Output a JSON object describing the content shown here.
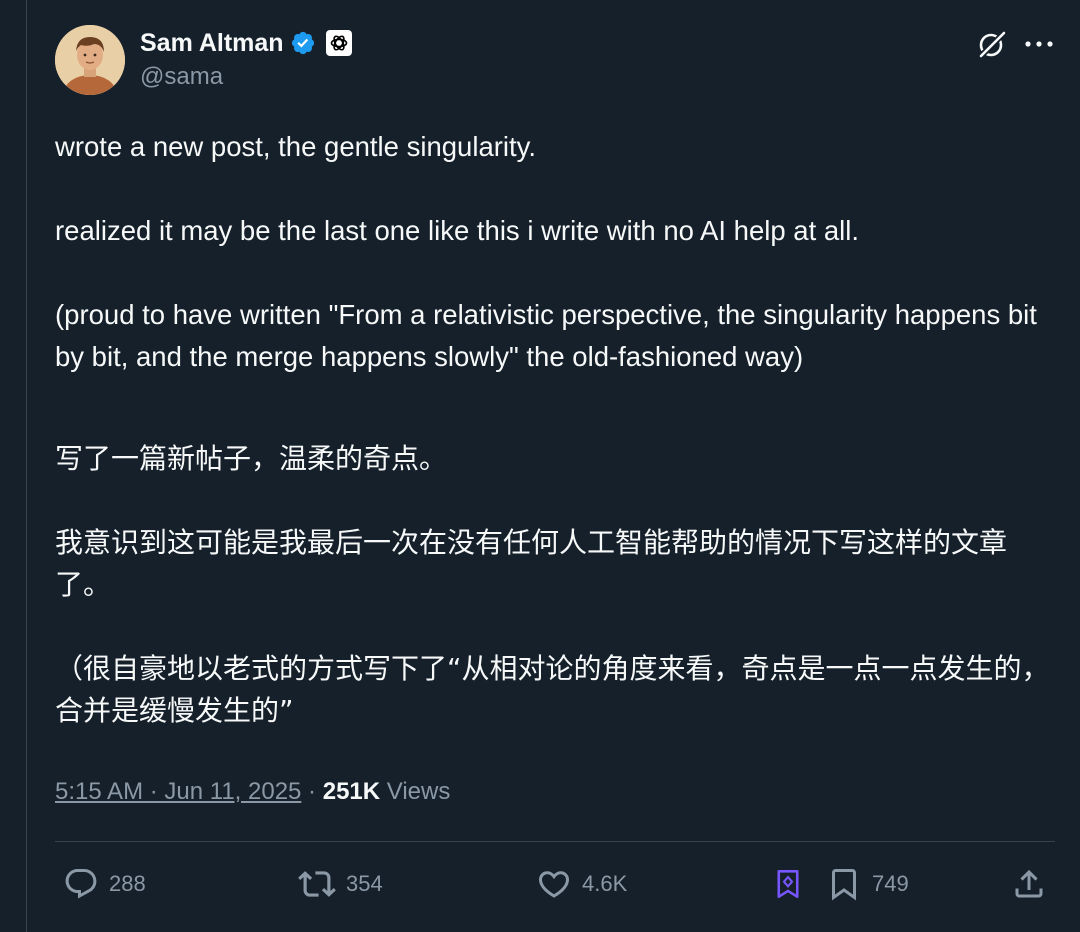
{
  "author": {
    "display_name": "Sam Altman",
    "handle": "@sama",
    "verified_color": "#1d9bf0"
  },
  "header_icons": {
    "grok": "grok-icon",
    "more": "more-icon"
  },
  "tweet": {
    "text": "wrote a new post, the gentle singularity.\n\nrealized it may be the last one like this i write with no AI help at all.\n\n(proud to have written \"From a relativistic perspective, the singularity happens bit by bit, and the merge happens slowly\" the old-fashioned way)",
    "translation": "写了一篇新帖子，温柔的奇点。\n\n我意识到这可能是我最后一次在没有任何人工智能帮助的情况下写这样的文章了。\n\n（很自豪地以老式的方式写下了“从相对论的角度来看，奇点是一点一点发生的，合并是缓慢发生的”"
  },
  "meta": {
    "timestamp": "5:15 AM · Jun 11, 2025",
    "separator": " · ",
    "views_count": "251K",
    "views_label": " Views"
  },
  "actions": {
    "replies": "288",
    "reposts": "354",
    "likes": "4.6K",
    "bookmarks": "749"
  },
  "colors": {
    "background": "#15202b",
    "text": "#f7f9f9",
    "secondary": "#8b98a5",
    "grok_accent": "#7856ff"
  }
}
